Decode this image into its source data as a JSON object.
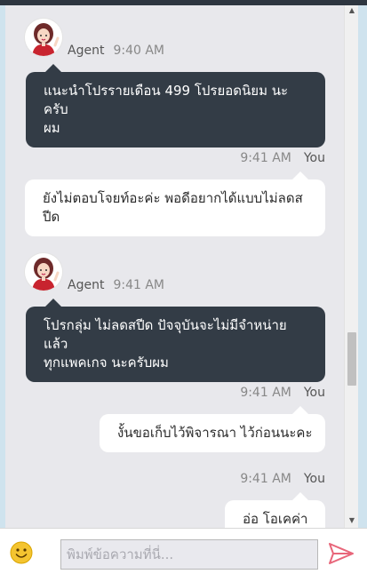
{
  "messages": [
    {
      "sender": "agent",
      "name": "Agent",
      "time": "9:40 AM",
      "lines": [
        "แนะนำโปรรายเดือน 499 โปรยอดนิยม นะครับ",
        "ผม"
      ]
    },
    {
      "sender": "user",
      "name": "You",
      "time": "9:41 AM",
      "lines": [
        "ยังไม่ตอบโจยท์อะค่ะ พอดีอยากได้แบบไม่ลดส",
        "ปีด"
      ]
    },
    {
      "sender": "agent",
      "name": "Agent",
      "time": "9:41 AM",
      "lines": [
        "โปรกลุ่ม ไม่ลดสปีด ปัจจุบันจะไม่มีจำหน่ายแล้ว",
        "ทุกแพคเกจ นะครับผม"
      ]
    },
    {
      "sender": "user",
      "name": "You",
      "time": "9:41 AM",
      "lines": [
        "งั้นขอเก็บไว้พิจารณา ไว้ก่อนนะคะ"
      ]
    },
    {
      "sender": "user",
      "name": "You",
      "time": "9:41 AM",
      "lines": [
        "อ่อ โอเคค่า"
      ]
    }
  ],
  "composer": {
    "placeholder": "พิมพ์ข้อความที่นี่...",
    "emoji_icon": "smiley-face-icon",
    "send_icon": "paper-plane-icon"
  },
  "colors": {
    "agent_bubble": "#333c46",
    "user_bubble": "#ffffff",
    "chat_background": "#e8e8ec",
    "send_icon": "#e8667a",
    "emoji_icon": "#f4c430"
  }
}
